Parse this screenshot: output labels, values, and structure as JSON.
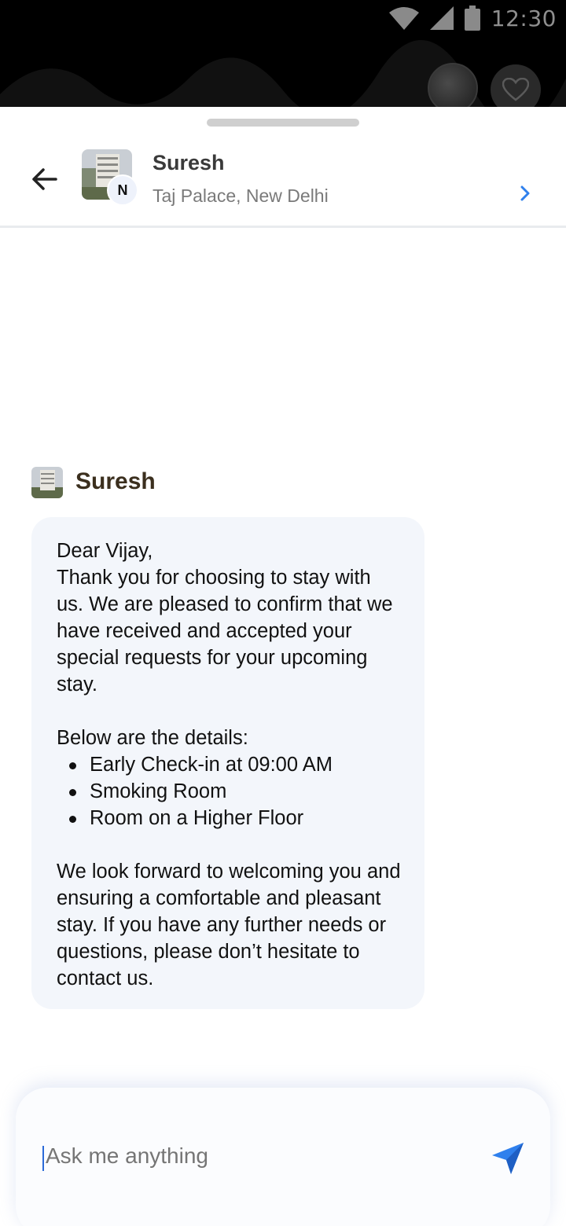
{
  "status": {
    "time": "12:30"
  },
  "header": {
    "agent_name": "Suresh",
    "subtitle": "Taj Palace, New Delhi",
    "badge": "N"
  },
  "message": {
    "sender": "Suresh",
    "greeting": "Dear Vijay,",
    "intro": "Thank you for choosing to stay with us. We are pleased to confirm that we have received and accepted your special requests for your upcoming stay.",
    "details_label": "Below are the details:",
    "details": [
      "Early Check-in at 09:00 AM",
      "Smoking Room",
      "Room on a Higher Floor"
    ],
    "closing": "We look forward to welcoming you and ensuring a comfortable and pleasant stay. If you have any further needs or questions, please don’t hesitate to contact us."
  },
  "composer": {
    "placeholder": "Ask me anything"
  },
  "colors": {
    "accent": "#2f80ed",
    "bubble": "#f3f6fb",
    "sender": "#3b2f1e"
  },
  "icons": [
    "wifi-icon",
    "signal-icon",
    "battery-icon",
    "heart-icon",
    "back-arrow-icon",
    "chevron-right-icon",
    "send-icon"
  ]
}
